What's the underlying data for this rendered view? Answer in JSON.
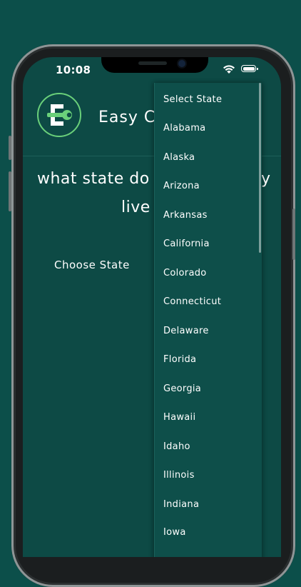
{
  "status_bar": {
    "time": "10:08"
  },
  "header": {
    "app_title": "Easy Cr",
    "logo_letter": "E"
  },
  "main": {
    "question_line1": "what state do",
    "question_line2": "live",
    "question_fragment": "y",
    "choose_label": "Choose State"
  },
  "dropdown": {
    "options": [
      "Select State",
      "Alabama",
      "Alaska",
      "Arizona",
      "Arkansas",
      "California",
      "Colorado",
      "Connecticut",
      "Delaware",
      "Florida",
      "Georgia",
      "Hawaii",
      "Idaho",
      "Illinois",
      "Indiana",
      "Iowa"
    ]
  },
  "colors": {
    "background": "#0c4f4a",
    "screen": "#0d4a45",
    "logo_accent": "#6ad07a"
  }
}
